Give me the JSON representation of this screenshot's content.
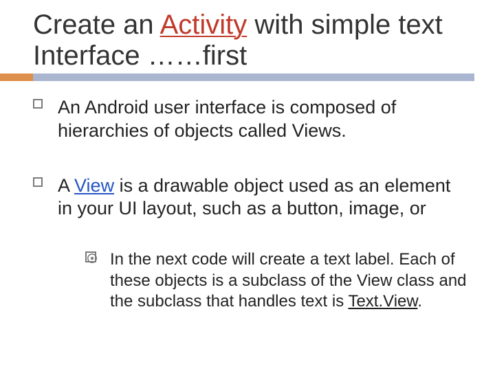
{
  "title": {
    "pre1": "Create an ",
    "accent": "Activity",
    "post1": " with simple text Interface ……first"
  },
  "bullets": {
    "b1": "An Android user interface is composed of hierarchies of objects called Views.",
    "b2": {
      "pre": "A ",
      "link": "View",
      "post": " is a drawable object used as an element in your UI layout, such as a button, image, or"
    },
    "b2sub": {
      "pre": " In the next code will create a text label. Each of these objects is a subclass of the View class and the subclass that handles text is ",
      "link": "Text.View",
      "post": "."
    }
  }
}
